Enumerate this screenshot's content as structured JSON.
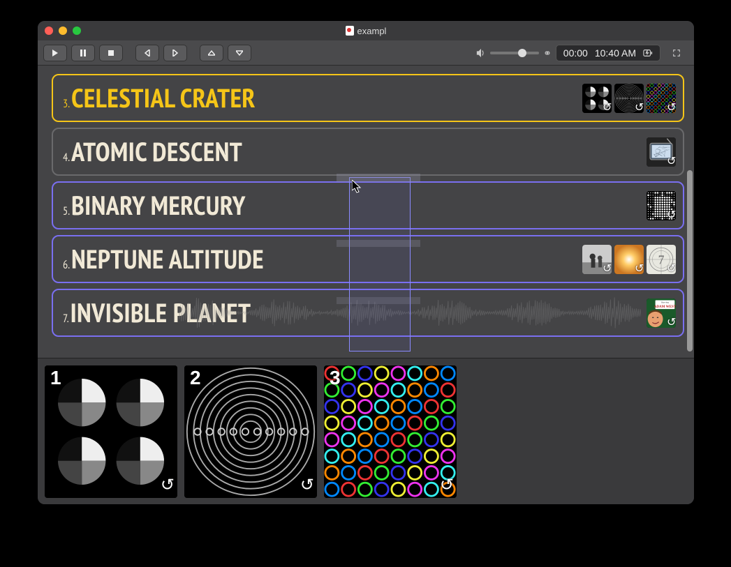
{
  "window": {
    "title": "exampl"
  },
  "toolbar": {
    "elapsed": "00:00",
    "clock": "10:40 AM"
  },
  "tracks": [
    {
      "num": "3.",
      "title": "CELESTIAL CRATER",
      "state": "current",
      "thumbs": [
        "pies",
        "rings",
        "mosaic"
      ]
    },
    {
      "num": "4.",
      "title": "ATOMIC DESCENT",
      "state": "normal",
      "thumbs": [
        "tv"
      ]
    },
    {
      "num": "5.",
      "title": "BINARY MERCURY",
      "state": "selected",
      "thumbs": [
        "dots"
      ]
    },
    {
      "num": "6.",
      "title": "NEPTUNE ALTITUDE",
      "state": "selected",
      "thumbs": [
        "photo",
        "sun",
        "countdown"
      ]
    },
    {
      "num": "7.",
      "title": "INVISIBLE PLANET",
      "state": "selected",
      "thumbs": [
        "adamwest"
      ],
      "waveform": true
    }
  ],
  "tray": [
    {
      "num": "1",
      "kind": "pies"
    },
    {
      "num": "2",
      "kind": "rings"
    },
    {
      "num": "3",
      "kind": "mosaic"
    }
  ],
  "thumb_meta": {
    "adamwest_line1": "Starring",
    "adamwest_line2": "ADAM WEST"
  }
}
